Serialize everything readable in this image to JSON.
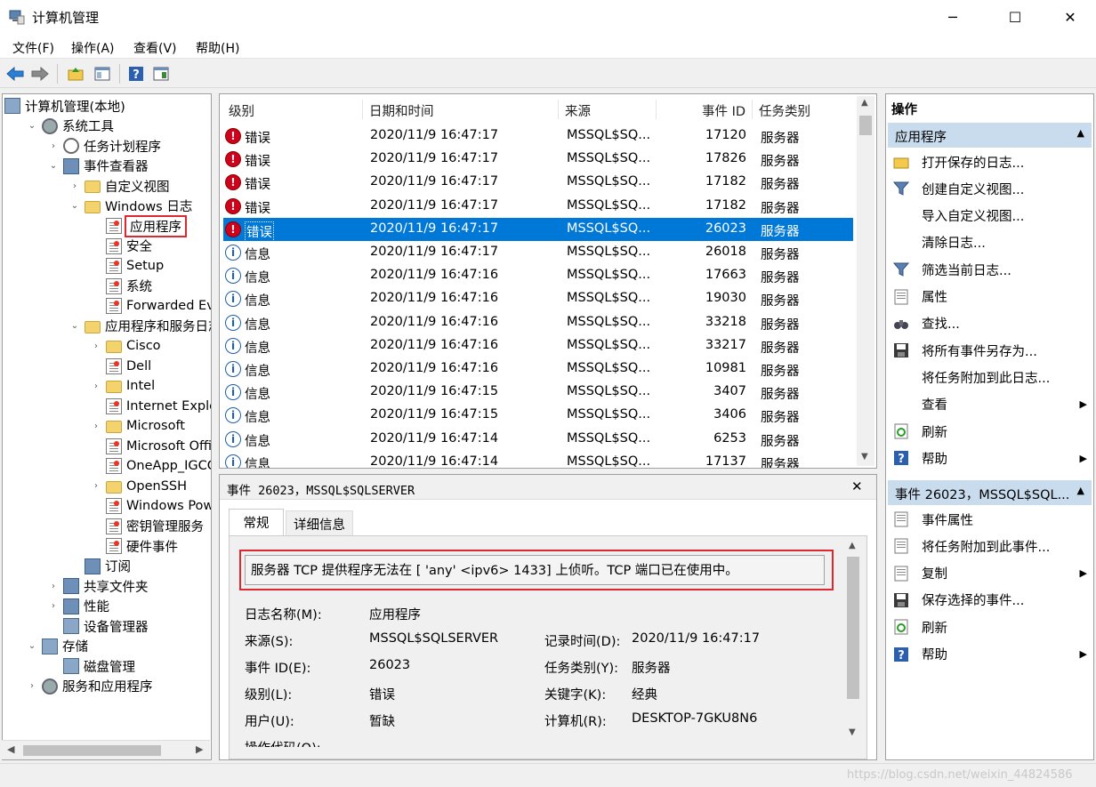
{
  "window": {
    "title": "计算机管理",
    "minimize": "─",
    "maximize": "☐",
    "close": "✕"
  },
  "menu": [
    "文件(F)",
    "操作(A)",
    "查看(V)",
    "帮助(H)"
  ],
  "tree": [
    {
      "label": "计算机管理(本地)",
      "depth": 0,
      "tw": "",
      "icon": "computer-management-icon"
    },
    {
      "label": "系统工具",
      "depth": 1,
      "tw": "⌄",
      "icon": "system-tools-icon"
    },
    {
      "label": "任务计划程序",
      "depth": 2,
      "tw": "›",
      "icon": "task-scheduler-icon"
    },
    {
      "label": "事件查看器",
      "depth": 2,
      "tw": "⌄",
      "icon": "event-viewer-icon"
    },
    {
      "label": "自定义视图",
      "depth": 3,
      "tw": "›",
      "icon": "folder-icon"
    },
    {
      "label": "Windows 日志",
      "depth": 3,
      "tw": "⌄",
      "icon": "folder-icon"
    },
    {
      "label": "应用程序",
      "depth": 4,
      "tw": "",
      "icon": "log-icon",
      "boxed": true
    },
    {
      "label": "安全",
      "depth": 4,
      "tw": "",
      "icon": "log-icon"
    },
    {
      "label": "Setup",
      "depth": 4,
      "tw": "",
      "icon": "log-icon"
    },
    {
      "label": "系统",
      "depth": 4,
      "tw": "",
      "icon": "log-icon"
    },
    {
      "label": "Forwarded Even",
      "depth": 4,
      "tw": "",
      "icon": "log-icon"
    },
    {
      "label": "应用程序和服务日志",
      "depth": 3,
      "tw": "⌄",
      "icon": "folder-icon"
    },
    {
      "label": "Cisco",
      "depth": 4,
      "tw": "›",
      "icon": "folder-icon"
    },
    {
      "label": "Dell",
      "depth": 4,
      "tw": "",
      "icon": "log-icon"
    },
    {
      "label": "Intel",
      "depth": 4,
      "tw": "›",
      "icon": "folder-icon"
    },
    {
      "label": "Internet Explore",
      "depth": 4,
      "tw": "",
      "icon": "log-icon"
    },
    {
      "label": "Microsoft",
      "depth": 4,
      "tw": "›",
      "icon": "folder-icon"
    },
    {
      "label": "Microsoft Office",
      "depth": 4,
      "tw": "",
      "icon": "log-icon"
    },
    {
      "label": "OneApp_IGCC",
      "depth": 4,
      "tw": "",
      "icon": "log-icon"
    },
    {
      "label": "OpenSSH",
      "depth": 4,
      "tw": "›",
      "icon": "folder-icon"
    },
    {
      "label": "Windows Power",
      "depth": 4,
      "tw": "",
      "icon": "log-icon"
    },
    {
      "label": "密钥管理服务",
      "depth": 4,
      "tw": "",
      "icon": "log-icon"
    },
    {
      "label": "硬件事件",
      "depth": 4,
      "tw": "",
      "icon": "log-icon"
    },
    {
      "label": "订阅",
      "depth": 3,
      "tw": "",
      "icon": "subscription-icon"
    },
    {
      "label": "共享文件夹",
      "depth": 2,
      "tw": "›",
      "icon": "shared-folders-icon"
    },
    {
      "label": "性能",
      "depth": 2,
      "tw": "›",
      "icon": "performance-icon"
    },
    {
      "label": "设备管理器",
      "depth": 2,
      "tw": "",
      "icon": "device-manager-icon"
    },
    {
      "label": "存储",
      "depth": 1,
      "tw": "⌄",
      "icon": "storage-icon"
    },
    {
      "label": "磁盘管理",
      "depth": 2,
      "tw": "",
      "icon": "disk-management-icon"
    },
    {
      "label": "服务和应用程序",
      "depth": 1,
      "tw": "›",
      "icon": "services-icon"
    }
  ],
  "list": {
    "headers": {
      "level": "级别",
      "datetime": "日期和时间",
      "source": "来源",
      "event_id": "事件 ID",
      "category": "任务类别"
    },
    "rows": [
      {
        "type": "error",
        "level": "错误",
        "datetime": "2020/11/9 16:47:17",
        "source": "MSSQL$SQ...",
        "id": "17120",
        "category": "服务器"
      },
      {
        "type": "error",
        "level": "错误",
        "datetime": "2020/11/9 16:47:17",
        "source": "MSSQL$SQ...",
        "id": "17826",
        "category": "服务器"
      },
      {
        "type": "error",
        "level": "错误",
        "datetime": "2020/11/9 16:47:17",
        "source": "MSSQL$SQ...",
        "id": "17182",
        "category": "服务器"
      },
      {
        "type": "error",
        "level": "错误",
        "datetime": "2020/11/9 16:47:17",
        "source": "MSSQL$SQ...",
        "id": "17182",
        "category": "服务器"
      },
      {
        "type": "error",
        "level": "错误",
        "datetime": "2020/11/9 16:47:17",
        "source": "MSSQL$SQ...",
        "id": "26023",
        "category": "服务器",
        "selected": true
      },
      {
        "type": "info",
        "level": "信息",
        "datetime": "2020/11/9 16:47:17",
        "source": "MSSQL$SQ...",
        "id": "26018",
        "category": "服务器"
      },
      {
        "type": "info",
        "level": "信息",
        "datetime": "2020/11/9 16:47:16",
        "source": "MSSQL$SQ...",
        "id": "17663",
        "category": "服务器"
      },
      {
        "type": "info",
        "level": "信息",
        "datetime": "2020/11/9 16:47:16",
        "source": "MSSQL$SQ...",
        "id": "19030",
        "category": "服务器"
      },
      {
        "type": "info",
        "level": "信息",
        "datetime": "2020/11/9 16:47:16",
        "source": "MSSQL$SQ...",
        "id": "33218",
        "category": "服务器"
      },
      {
        "type": "info",
        "level": "信息",
        "datetime": "2020/11/9 16:47:16",
        "source": "MSSQL$SQ...",
        "id": "33217",
        "category": "服务器"
      },
      {
        "type": "info",
        "level": "信息",
        "datetime": "2020/11/9 16:47:16",
        "source": "MSSQL$SQ...",
        "id": "10981",
        "category": "服务器"
      },
      {
        "type": "info",
        "level": "信息",
        "datetime": "2020/11/9 16:47:15",
        "source": "MSSQL$SQ...",
        "id": "3407",
        "category": "服务器"
      },
      {
        "type": "info",
        "level": "信息",
        "datetime": "2020/11/9 16:47:15",
        "source": "MSSQL$SQ...",
        "id": "3406",
        "category": "服务器"
      },
      {
        "type": "info",
        "level": "信息",
        "datetime": "2020/11/9 16:47:14",
        "source": "MSSQL$SQ...",
        "id": "6253",
        "category": "服务器"
      },
      {
        "type": "info",
        "level": "信息",
        "datetime": "2020/11/9 16:47:14",
        "source": "MSSQL$SQ...",
        "id": "17137",
        "category": "服务器"
      }
    ]
  },
  "detail": {
    "title": "事件 26023，MSSQL$SQLSERVER",
    "close": "✕",
    "tabs": [
      "常规",
      "详细信息"
    ],
    "message": "服务器 TCP 提供程序无法在 [ 'any' <ipv6> 1433] 上侦听。TCP 端口已在使用中。",
    "fields": {
      "log_name_label": "日志名称(M):",
      "log_name": "应用程序",
      "source_label": "来源(S):",
      "source": "MSSQL$SQLSERVER",
      "logged_label": "记录时间(D):",
      "logged": "2020/11/9 16:47:17",
      "event_id_label": "事件 ID(E):",
      "event_id": "26023",
      "category_label": "任务类别(Y):",
      "category": "服务器",
      "level_label": "级别(L):",
      "level": "错误",
      "keywords_label": "关键字(K):",
      "keywords": "经典",
      "user_label": "用户(U):",
      "user": "暂缺",
      "computer_label": "计算机(R):",
      "computer": "DESKTOP-7GKU8N6",
      "opcode_label": "操作代码(O):"
    }
  },
  "actions": {
    "title": "操作",
    "section1": "应用程序",
    "items1": [
      {
        "label": "打开保存的日志...",
        "icon": "open-folder-icon"
      },
      {
        "label": "创建自定义视图...",
        "icon": "filter-icon"
      },
      {
        "label": "导入自定义视图...",
        "icon": ""
      },
      {
        "label": "清除日志...",
        "icon": ""
      },
      {
        "label": "筛选当前日志...",
        "icon": "filter-icon"
      },
      {
        "label": "属性",
        "icon": "properties-icon"
      },
      {
        "label": "查找...",
        "icon": "find-icon"
      },
      {
        "label": "将所有事件另存为...",
        "icon": "save-icon"
      },
      {
        "label": "将任务附加到此日志...",
        "icon": ""
      },
      {
        "label": "查看",
        "icon": "",
        "submenu": true
      },
      {
        "label": "刷新",
        "icon": "refresh-icon"
      },
      {
        "label": "帮助",
        "icon": "help-icon",
        "submenu": true
      }
    ],
    "section2": "事件 26023，MSSQL$SQL...",
    "items2": [
      {
        "label": "事件属性",
        "icon": "event-properties-icon"
      },
      {
        "label": "将任务附加到此事件...",
        "icon": "task-icon"
      },
      {
        "label": "复制",
        "icon": "copy-icon",
        "submenu": true
      },
      {
        "label": "保存选择的事件...",
        "icon": "save-icon"
      },
      {
        "label": "刷新",
        "icon": "refresh-icon"
      },
      {
        "label": "帮助",
        "icon": "help-icon",
        "submenu": true
      }
    ]
  },
  "watermark": "https://blog.csdn.net/weixin_44824586"
}
